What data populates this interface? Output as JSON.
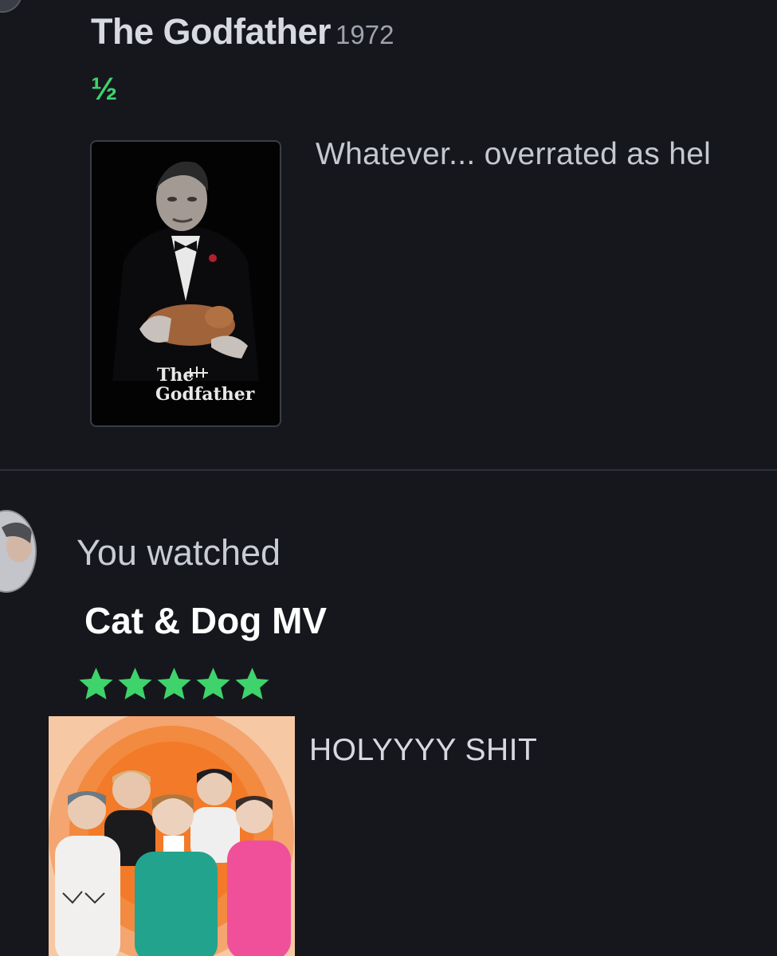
{
  "entry1": {
    "title": "The Godfather",
    "year": "1972",
    "rating_text": "½",
    "rating_value": 0.5,
    "poster_text_1": "The",
    "poster_text_2": "Godfather",
    "review": "Whatever... overrated as hel"
  },
  "entry2": {
    "watched_label": "You watched",
    "title": "Cat & Dog MV",
    "rating_value": 5,
    "stars": [
      "★",
      "★",
      "★",
      "★",
      "★"
    ],
    "review": "HOLYYYY SHIT"
  },
  "colors": {
    "background": "#16171d",
    "accent_green": "#3ed36b",
    "divider": "#2e3038"
  },
  "icons": [
    "star-icon",
    "avatar"
  ]
}
